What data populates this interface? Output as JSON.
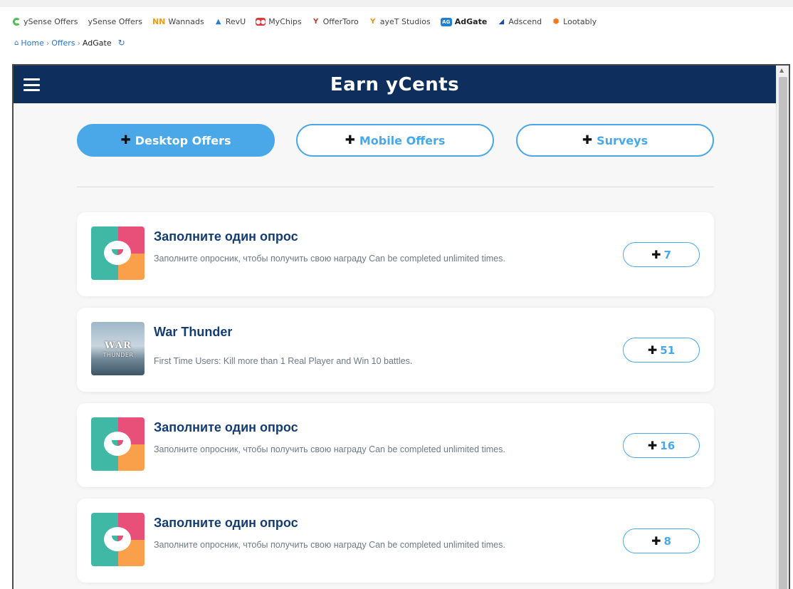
{
  "tabs": [
    {
      "label": "ySense Offers",
      "icon": "spiral-icon"
    },
    {
      "label": "ySense Offers",
      "icon": ""
    },
    {
      "label": "Wannads",
      "icon": "wannads-icon"
    },
    {
      "label": "RevU",
      "icon": "revu-icon"
    },
    {
      "label": "MyChips",
      "icon": "mychips-icon"
    },
    {
      "label": "OfferToro",
      "icon": "offertoro-icon"
    },
    {
      "label": "ayeT Studios",
      "icon": "ayet-icon"
    },
    {
      "label": "AdGate",
      "icon": "adgate-icon",
      "active": true
    },
    {
      "label": "Adscend",
      "icon": "adscend-icon"
    },
    {
      "label": "Lootably",
      "icon": "lootably-icon"
    }
  ],
  "breadcrumb": {
    "home": "Home",
    "offers": "Offers",
    "current": "AdGate"
  },
  "header": {
    "title": "Earn yCents"
  },
  "categories": [
    {
      "label": "Desktop Offers",
      "active": true
    },
    {
      "label": "Mobile Offers"
    },
    {
      "label": "Surveys"
    }
  ],
  "offers": [
    {
      "title": "Заполните один опрос",
      "desc": "Заполните опросник, чтобы получить свою награду",
      "note": "Can be completed unlimited times.",
      "reward": "7"
    },
    {
      "title": "War Thunder",
      "desc": "First Time Users: Kill more than 1 Real Player and Win 10 battles.",
      "note": "",
      "reward": "51"
    },
    {
      "title": "Заполните один опрос",
      "desc": "Заполните опросник, чтобы получить свою награду",
      "note": "Can be completed unlimited times.",
      "reward": "16"
    },
    {
      "title": "Заполните один опрос",
      "desc": "Заполните опросник, чтобы получить свою награду",
      "note": "Can be completed unlimited times.",
      "reward": "8"
    }
  ],
  "colors": {
    "header_bg": "#0e2f5e",
    "accent": "#4aa8e8",
    "title": "#143d72"
  }
}
